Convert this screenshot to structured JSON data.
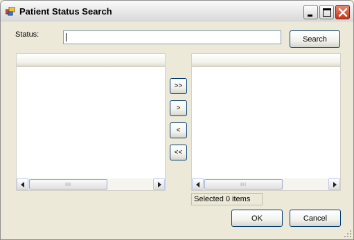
{
  "window": {
    "title": "Patient Status Search",
    "title_icon": "app-window-icon"
  },
  "form": {
    "status_label": "Status:",
    "status_value": "",
    "search_label": "Search"
  },
  "transfer_buttons": {
    "add_all": ">>",
    "add_one": ">",
    "remove_one": "<",
    "remove_all": "<<"
  },
  "selection": {
    "summary": "Selected 0 items"
  },
  "footer": {
    "ok_label": "OK",
    "cancel_label": "Cancel"
  },
  "scrollbar_grip": "III",
  "colors": {
    "window_bg": "#ece9d8",
    "button_border": "#003c74",
    "close_button": "#c4361b",
    "textbox_border": "#7f9db9"
  }
}
